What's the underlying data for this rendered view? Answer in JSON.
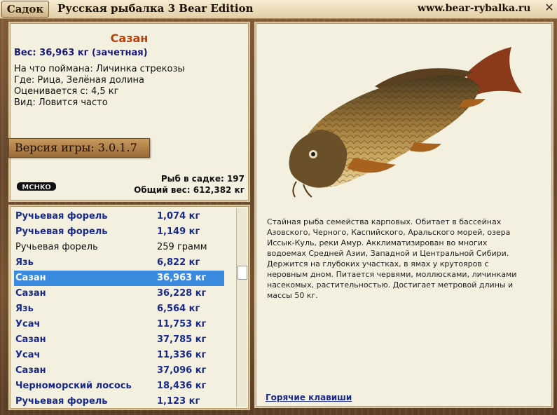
{
  "header": {
    "tab_label": "Садок",
    "app_title": "Русская рыбалка 3 Bear Edition",
    "site": "www.bear-rybalka.ru",
    "close_icon": "close-icon"
  },
  "fish": {
    "name": "Сазан",
    "weight_line": "Вес: 36,963 кг (зачетная)",
    "bait_line": "На что поймана: Личинка стрекозы",
    "where_line": "Где: Рица, Зелёная долина",
    "value_line": "Оценивается с: 4,5 кг",
    "type_line": "Вид: Ловится часто"
  },
  "game": {
    "version": "Версия игры: 3.0.1.7",
    "logo_text": "MCHKO",
    "fish_count": "Рыб в садке: 197",
    "total_weight": "Общий вес: 612,382 кг"
  },
  "catch_list": [
    {
      "name": "Ручьевая форель",
      "weight": "1,074 кг",
      "style": "b"
    },
    {
      "name": "Ручьевая форель",
      "weight": "1,149 кг",
      "style": "b"
    },
    {
      "name": "Ручьевая форель",
      "weight": "259 грамм",
      "style": "plain"
    },
    {
      "name": "Язь",
      "weight": "6,822 кг",
      "style": "b"
    },
    {
      "name": "Сазан",
      "weight": "36,963 кг",
      "style": "sel"
    },
    {
      "name": "Сазан",
      "weight": "36,228 кг",
      "style": "b"
    },
    {
      "name": "Язь",
      "weight": "6,564 кг",
      "style": "b"
    },
    {
      "name": "Усач",
      "weight": "11,753 кг",
      "style": "b"
    },
    {
      "name": "Сазан",
      "weight": "37,785 кг",
      "style": "b"
    },
    {
      "name": "Усач",
      "weight": "11,336 кг",
      "style": "b"
    },
    {
      "name": "Сазан",
      "weight": "37,096 кг",
      "style": "b"
    },
    {
      "name": "Черноморский лосось",
      "weight": "18,436 кг",
      "style": "b"
    },
    {
      "name": "Ручьевая форель",
      "weight": "1,123 кг",
      "style": "b"
    }
  ],
  "description": {
    "text": "Стайная рыба семейства карповых. Обитает в бассейнах Азовского, Черного, Каспийского, Аральского морей, озера Иссык-Куль, реки Амур. Акклиматизирован во многих водоемах Средней Азии, Западной и Центральной Сибири. Держится на глубоких  участках, в ямах у крутояров с неровным дном. Питается червями, моллюсками, личинками насекомых, растительностью. Достигает метровой длины и массы 50 кг.",
    "hotkeys": "Горячие клавиши"
  }
}
